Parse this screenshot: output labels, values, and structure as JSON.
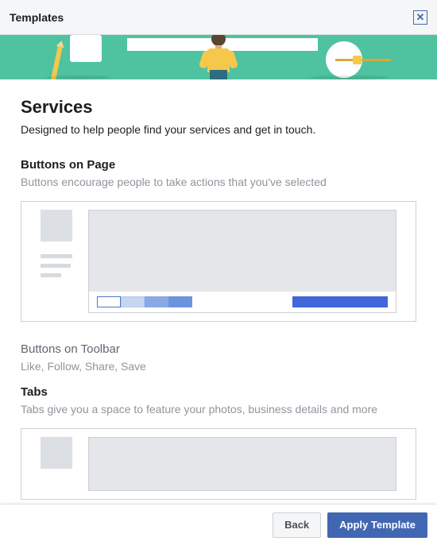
{
  "header": {
    "title": "Templates"
  },
  "hero": {
    "name": "hero-illustration"
  },
  "main": {
    "title": "Services",
    "description": "Designed to help people find your services and get in touch.",
    "sections": {
      "buttonsOnPage": {
        "heading": "Buttons on Page",
        "desc": "Buttons encourage people to take actions that you've selected"
      },
      "buttonsOnToolbar": {
        "heading": "Buttons on Toolbar",
        "desc": "Like, Follow, Share, Save"
      },
      "tabs": {
        "heading": "Tabs",
        "desc": "Tabs give you a space to feature your photos, business details and more"
      }
    }
  },
  "footer": {
    "back": "Back",
    "apply": "Apply Template"
  }
}
